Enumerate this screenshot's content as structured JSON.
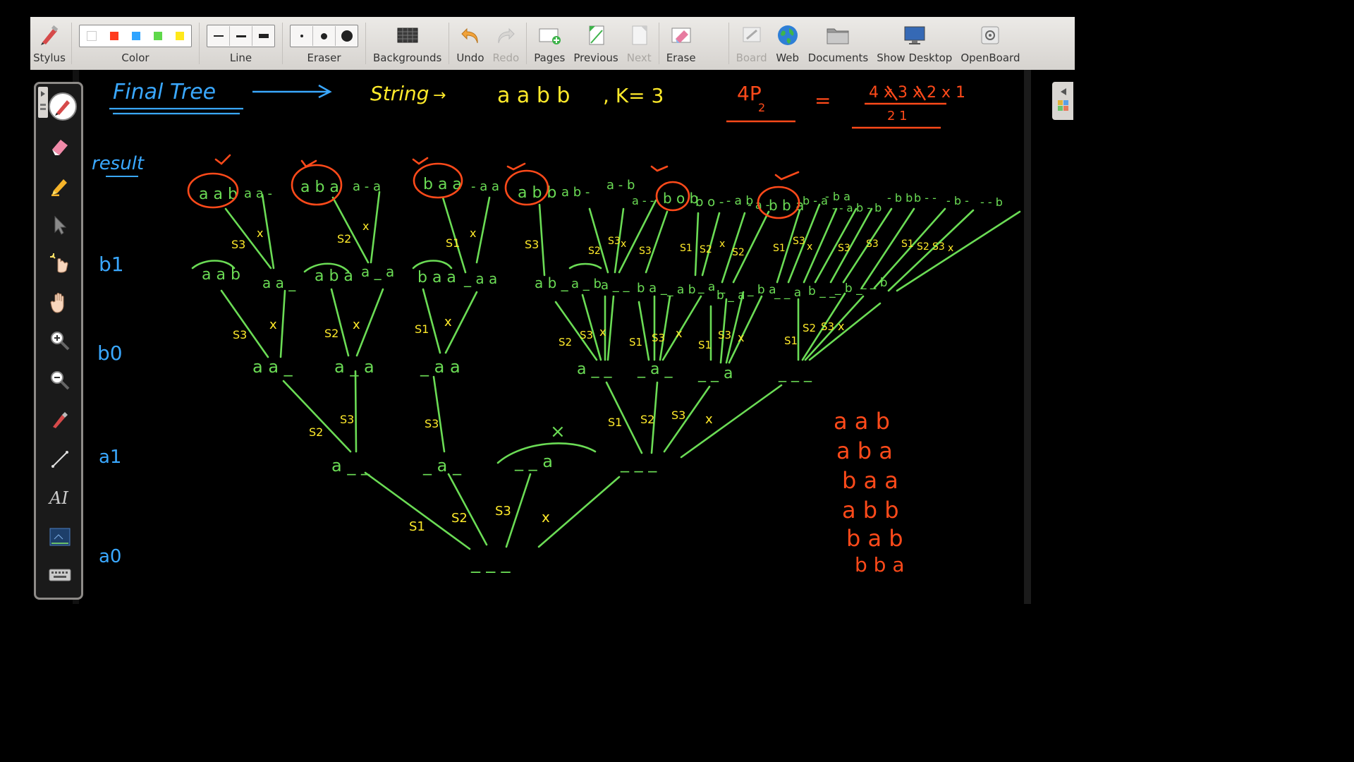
{
  "toolbar": {
    "items": [
      {
        "label": "Stylus",
        "icon": "stylus-icon"
      },
      {
        "label": "Color",
        "icon": "color-palette"
      },
      {
        "label": "Line",
        "icon": "line-width-icon"
      },
      {
        "label": "Eraser",
        "icon": "eraser-size-icon"
      },
      {
        "label": "Backgrounds",
        "icon": "backgrounds-icon"
      },
      {
        "label": "Undo",
        "icon": "undo-icon"
      },
      {
        "label": "Redo",
        "icon": "redo-icon"
      },
      {
        "label": "Pages",
        "icon": "pages-icon"
      },
      {
        "label": "Previous",
        "icon": "previous-icon"
      },
      {
        "label": "Next",
        "icon": "next-icon"
      },
      {
        "label": "Erase",
        "icon": "erase-icon"
      },
      {
        "label": "Board",
        "icon": "board-icon"
      },
      {
        "label": "Web",
        "icon": "web-icon"
      },
      {
        "label": "Documents",
        "icon": "documents-icon"
      },
      {
        "label": "Show Desktop",
        "icon": "show-desktop-icon"
      },
      {
        "label": "OpenBoard",
        "icon": "openboard-icon"
      }
    ],
    "colors": [
      "#ffffff",
      "#ff3b1f",
      "#2fa4ff",
      "#5fd84a",
      "#ffe81a"
    ]
  },
  "sidebar_tools": [
    "pen-icon",
    "eraser-icon",
    "marker-icon",
    "selector-icon",
    "laser-pointer-icon",
    "hand-icon",
    "zoom-in-icon",
    "zoom-out-icon",
    "pointer-pen-icon",
    "line-icon",
    "text-icon",
    "capture-icon",
    "keyboard-icon"
  ],
  "board": {
    "title": "Final Tree",
    "string_label": "String",
    "string_value": "a a b b",
    "k_label": ", K= 3",
    "perm_left": "4P",
    "perm_sub": "2",
    "perm_eq": "=",
    "perm_right": "4 x 3 x 2 x 1",
    "level_labels": [
      "result",
      "b1",
      "b0",
      "a1",
      "a0"
    ],
    "root": "_ _ _",
    "level1": [
      "a _ _",
      "_ a _",
      "_ _ a",
      "_ _ _"
    ],
    "level2": [
      "a a _",
      "a _ a",
      "_ a a",
      "a _ _",
      "_ a _",
      "_ _ a",
      "_ _ _"
    ],
    "level3": [
      "a a b",
      "a a _",
      "a b a",
      "a _ a",
      "b a a",
      "_ a a",
      "a b _",
      "a _ b",
      "a _ _",
      "b a _",
      "_ a b",
      "_ a _",
      "b _ a",
      "_ b a",
      "_ _ a",
      "b _ _",
      "_ b _",
      "_ _ b"
    ],
    "results_top": [
      "a a b",
      "a a -",
      "a b a",
      "a - a",
      "b a a",
      "- a a",
      "a b b",
      "a b -",
      "a - b",
      "a - -",
      "b o b",
      "b o -",
      "- a b",
      "- a -",
      "b b a",
      "b - a",
      "- b a",
      "- - a",
      "b - b",
      "- b b",
      "b - -",
      "- b -",
      "- - b"
    ],
    "edge_labels": [
      "S1",
      "S2",
      "S3",
      "x"
    ],
    "final_results": [
      "a a b",
      "a b a",
      "b a a",
      "a b b",
      "b a b",
      "b b a"
    ]
  }
}
